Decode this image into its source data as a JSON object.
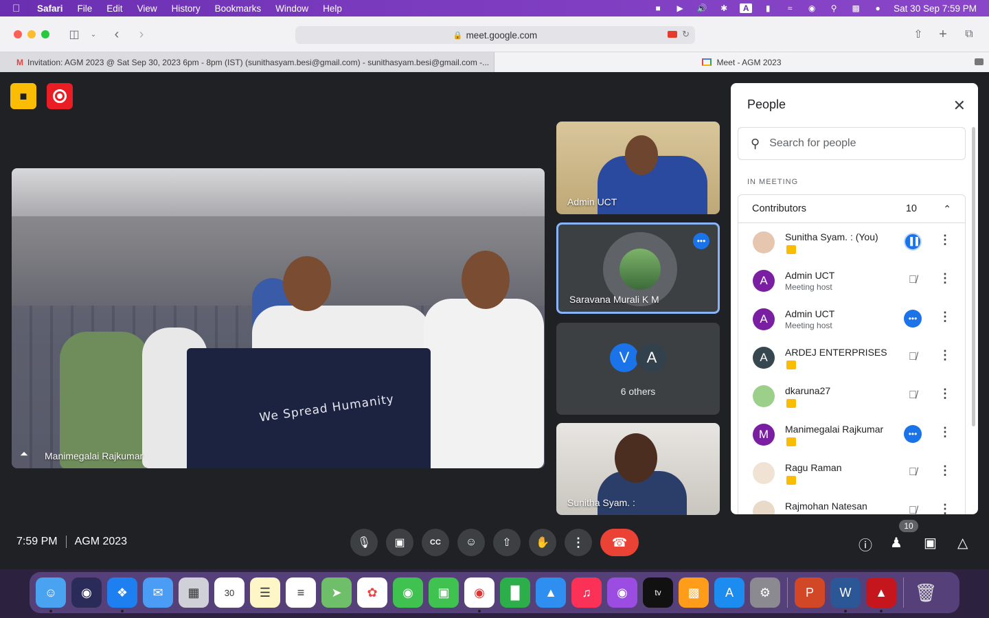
{
  "menubar": {
    "app": "Safari",
    "items": [
      "File",
      "Edit",
      "View",
      "History",
      "Bookmarks",
      "Window",
      "Help"
    ],
    "datetime": "Sat 30 Sep  7:59 PM"
  },
  "browser": {
    "url": "meet.google.com",
    "tabs": [
      {
        "title": "Invitation: AGM 2023 @ Sat Sep 30, 2023 6pm - 8pm (IST) (sunithasyam.besi@gmail.com) - sunithasyam.besi@gmail.com -..."
      },
      {
        "title": "Meet - AGM 2023"
      }
    ]
  },
  "meet": {
    "main_tile_name": "Manimegalai Rajkumar",
    "shirt_text": "We Spread Humanity",
    "tiles": [
      {
        "name": "Admin UCT"
      },
      {
        "name": "Saravana Murali K M"
      },
      {
        "name": "6 others",
        "initials": [
          "V",
          "A"
        ]
      },
      {
        "name": "Sunitha Syam. :"
      }
    ],
    "time": "7:59 PM",
    "meeting_title": "AGM 2023",
    "people_count_badge": "10"
  },
  "people_panel": {
    "title": "People",
    "search_placeholder": "Search for people",
    "section": "IN MEETING",
    "group_label": "Contributors",
    "group_count": "10",
    "participants": [
      {
        "name": "Sunitha Syam. : (You)",
        "sub": "",
        "avatar": "",
        "state": "speaking"
      },
      {
        "name": "Admin UCT",
        "sub": "Meeting host",
        "avatar": "A",
        "state": "muted"
      },
      {
        "name": "Admin UCT",
        "sub": "Meeting host",
        "avatar": "A",
        "state": "more"
      },
      {
        "name": "ARDEJ ENTERPRISES",
        "sub": "",
        "avatar": "A",
        "state": "muted"
      },
      {
        "name": "dkaruna27",
        "sub": "",
        "avatar": "",
        "state": "muted"
      },
      {
        "name": "Manimegalai Rajkumar",
        "sub": "",
        "avatar": "M",
        "state": "more"
      },
      {
        "name": "Ragu Raman",
        "sub": "",
        "avatar": "",
        "state": "muted"
      },
      {
        "name": "Rajmohan Natesan",
        "sub": "",
        "avatar": "",
        "state": "muted"
      }
    ]
  },
  "colors": {
    "meet_bg": "#202124",
    "accent_blue": "#1a73e8",
    "hangup_red": "#ea4335",
    "recording_red": "#ea1c24",
    "badge_yellow": "#fbbc04"
  }
}
